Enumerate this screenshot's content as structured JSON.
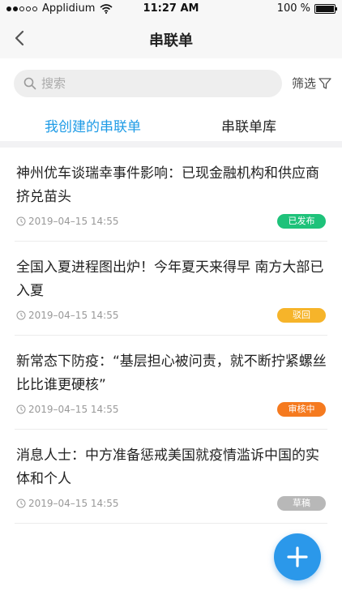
{
  "status_bar": {
    "carrier": "Applidium",
    "time": "11:27 AM",
    "battery": "100 %"
  },
  "navbar": {
    "back_icon": "chevron-left-icon",
    "title": "串联单"
  },
  "search": {
    "placeholder": "搜索",
    "filter_label": "筛选"
  },
  "tabs": [
    {
      "label": "我创建的串联单",
      "active": true
    },
    {
      "label": "串联单库",
      "active": false
    }
  ],
  "list": [
    {
      "title": "神州优车谈瑞幸事件影响：已现金融机构和供应商挤兑苗头",
      "datetime": "2019–04–15   14:55",
      "status": "已发布",
      "status_color": "#1ec27a"
    },
    {
      "title": "全国入夏进程图出炉！今年夏天来得早 南方大部已入夏",
      "datetime": "2019–04–15   14:55",
      "status": "驳回",
      "status_color": "#f6b42a"
    },
    {
      "title": "新常态下防疫：“基层担心被问责，就不断拧紧螺丝比比谁更硬核”",
      "datetime": "2019–04–15   14:55",
      "status": "审核中",
      "status_color": "#f57a1f"
    },
    {
      "title": "消息人士：中方准备惩戒美国就疫情滥诉中国的实体和个人",
      "datetime": "2019–04–15   14:55",
      "status": "草稿",
      "status_color": "#b8b8b8"
    }
  ],
  "fab": {
    "icon": "plus-icon"
  },
  "colors": {
    "accent": "#1e9be6",
    "fab": "#2b98ea"
  }
}
